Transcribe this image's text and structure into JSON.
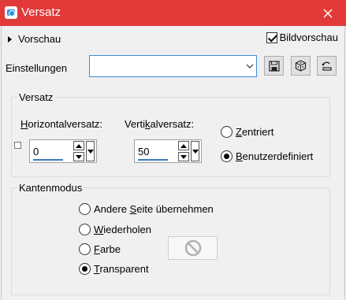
{
  "window": {
    "title": "Versatz",
    "accent": "#e13a38"
  },
  "toolbar": {
    "preview_label": "Vorschau",
    "image_preview_label": "Bildvorschau",
    "image_preview_checked": true,
    "settings_label": "Einstellungen",
    "settings_value": ""
  },
  "offset_group": {
    "title": "Versatz",
    "horizontal_label_u": "H",
    "horizontal_label_rest": "orizontalversatz:",
    "horizontal_value": "0",
    "vertical_label_a": "Verti",
    "vertical_label_u": "k",
    "vertical_label_b": "alversatz:",
    "vertical_value": "50",
    "centered_u": "Z",
    "centered_rest": "entriert",
    "custom_u": "B",
    "custom_rest": "enutzerdefiniert",
    "selected": "custom"
  },
  "edge_group": {
    "title": "Kantenmodus",
    "other_side_a": "Andere ",
    "other_side_u": "S",
    "other_side_b": "eite übernehmen",
    "repeat_u": "W",
    "repeat_rest": "iederholen",
    "color_u": "F",
    "color_rest": "arbe",
    "transparent_u": "T",
    "transparent_rest": "ransparent",
    "selected": "transparent"
  },
  "icons": {
    "app": "camera-icon",
    "close": "close-icon",
    "save": "save-icon",
    "random": "dice-icon",
    "reset": "reset-icon",
    "no_color": "no-symbol-icon"
  }
}
